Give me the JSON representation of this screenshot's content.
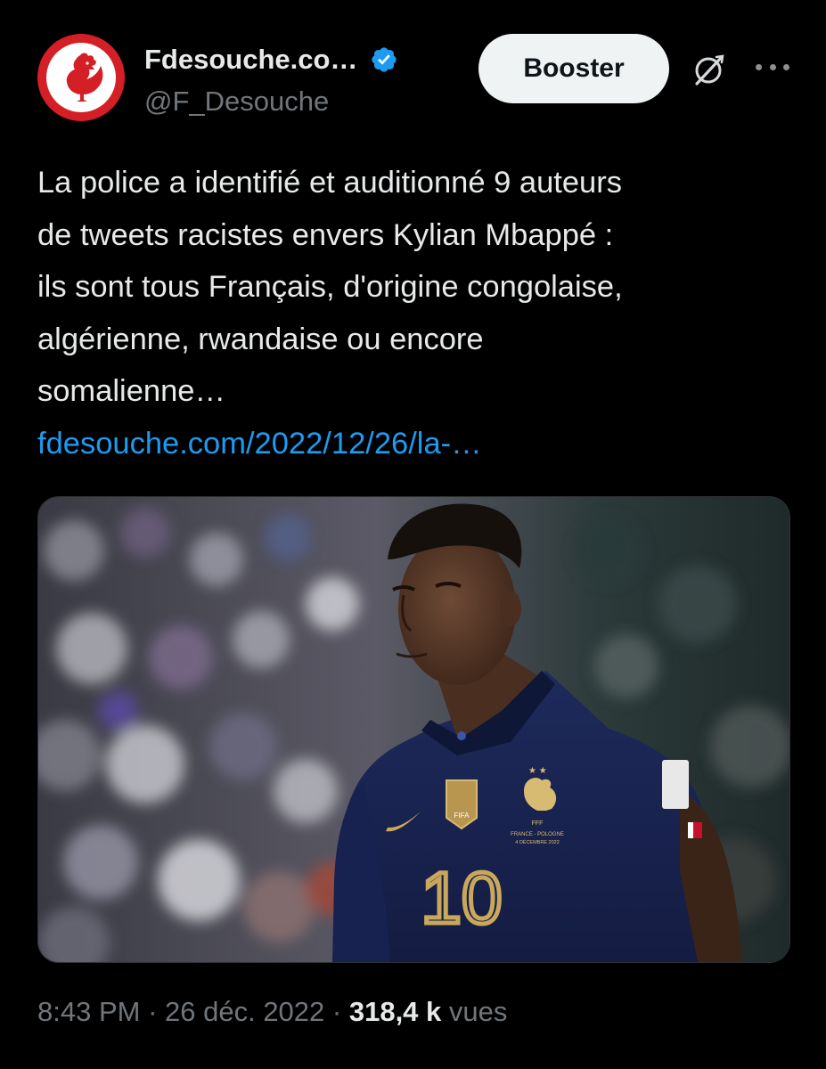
{
  "author": {
    "display_name": "Fdesouche.co…",
    "handle": "@F_Desouche",
    "avatar_icon": "rooster-logo-icon",
    "verified_icon": "verified-badge-icon",
    "verified_color": "#1d9bf0",
    "avatar_color": "#d41f26"
  },
  "actions": {
    "booster_label": "Booster",
    "grok_icon": "grok-icon",
    "more_icon": "more-options-icon"
  },
  "tweet": {
    "lines": [
      "La police a identifié et auditionné 9 auteurs",
      "de tweets racistes envers Kylian Mbappé :",
      "ils sont tous Français, d'origine congolaise,",
      "algérienne, rwandaise ou encore",
      "somalienne…"
    ],
    "link": "fdesouche.com/2022/12/26/la-…",
    "link_color": "#1d9bf0"
  },
  "media": {
    "jersey_number": "10",
    "jersey_badge_text": "FIFA",
    "jersey_crest_text": "FFF",
    "jersey_match_text": "FRANCE - POLOGNE",
    "jersey_date_text": "4 DÉCEMBRE 2022"
  },
  "footer": {
    "time": "8:43 PM",
    "separator": " · ",
    "date": "26 déc. 2022",
    "views_count": "318,4 k",
    "views_label": "vues"
  }
}
